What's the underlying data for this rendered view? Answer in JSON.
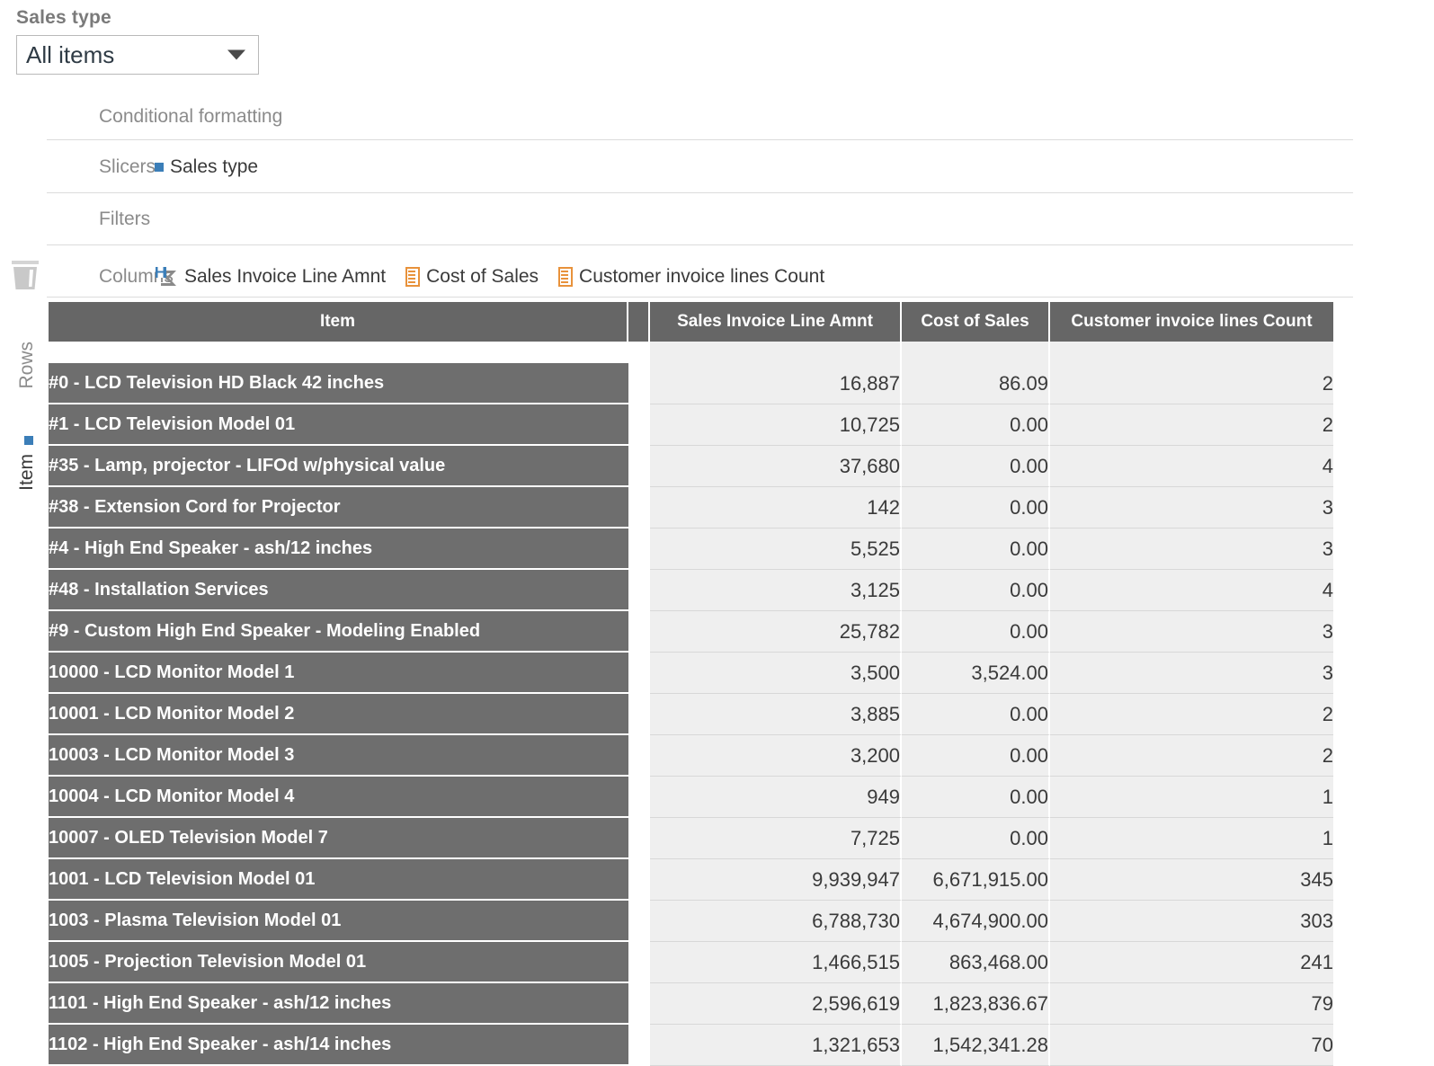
{
  "slicer": {
    "title": "Sales type",
    "selected_value": "All items",
    "caret_icon": "chevron-down-icon"
  },
  "zones": [
    {
      "label": "Conditional formatting",
      "fields": []
    },
    {
      "label": "Slicers",
      "fields": [
        {
          "name": "Sales type",
          "icon": "blue-square-icon"
        }
      ]
    },
    {
      "label": "Filters",
      "fields": []
    },
    {
      "label": "Columns",
      "fields": [
        {
          "name": "Sales Invoice Line Amnt",
          "icon": "sigma-measure-icon"
        },
        {
          "name": "Cost of Sales",
          "icon": "orange-list-icon"
        },
        {
          "name": "Customer invoice lines Count",
          "icon": "orange-list-icon"
        }
      ]
    }
  ],
  "rows_axis": {
    "label": "Rows",
    "field": "Item",
    "bullet_icon": "blue-square-icon"
  },
  "trash": {
    "icon": "trash-bin-icon"
  },
  "colors": {
    "header_gray": "#666666",
    "row_header_gray": "#6e6e6e",
    "cell_gray": "#efefef",
    "accent_blue": "#3b7eb8",
    "accent_orange": "#e8923b"
  },
  "table": {
    "columns": [
      "Item",
      "Sales Invoice Line Amnt",
      "Cost of Sales",
      "Customer invoice lines Count"
    ],
    "rows": [
      {
        "item": "#0 - LCD Television HD Black 42 inches",
        "amnt": "16,887",
        "cost": "86.09",
        "count": "2"
      },
      {
        "item": "#1 - LCD Television Model 01",
        "amnt": "10,725",
        "cost": "0.00",
        "count": "2"
      },
      {
        "item": "#35 - Lamp, projector - LIFOd w/physical value",
        "amnt": "37,680",
        "cost": "0.00",
        "count": "4"
      },
      {
        "item": "#38 - Extension Cord for Projector",
        "amnt": "142",
        "cost": "0.00",
        "count": "3"
      },
      {
        "item": "#4 - High End Speaker - ash/12 inches",
        "amnt": "5,525",
        "cost": "0.00",
        "count": "3"
      },
      {
        "item": "#48 - Installation Services",
        "amnt": "3,125",
        "cost": "0.00",
        "count": "4"
      },
      {
        "item": "#9 - Custom High End Speaker - Modeling Enabled",
        "amnt": "25,782",
        "cost": "0.00",
        "count": "3"
      },
      {
        "item": "10000 - LCD Monitor Model 1",
        "amnt": "3,500",
        "cost": "3,524.00",
        "count": "3"
      },
      {
        "item": "10001 - LCD Monitor Model 2",
        "amnt": "3,885",
        "cost": "0.00",
        "count": "2"
      },
      {
        "item": "10003 - LCD Monitor Model 3",
        "amnt": "3,200",
        "cost": "0.00",
        "count": "2"
      },
      {
        "item": "10004 - LCD Monitor Model 4",
        "amnt": "949",
        "cost": "0.00",
        "count": "1"
      },
      {
        "item": "10007 - OLED Television Model 7",
        "amnt": "7,725",
        "cost": "0.00",
        "count": "1"
      },
      {
        "item": "1001 - LCD Television Model 01",
        "amnt": "9,939,947",
        "cost": "6,671,915.00",
        "count": "345"
      },
      {
        "item": "1003 - Plasma Television Model 01",
        "amnt": "6,788,730",
        "cost": "4,674,900.00",
        "count": "303"
      },
      {
        "item": "1005 - Projection Television Model 01",
        "amnt": "1,466,515",
        "cost": "863,468.00",
        "count": "241"
      },
      {
        "item": "1101 - High End Speaker - ash/12 inches",
        "amnt": "2,596,619",
        "cost": "1,823,836.67",
        "count": "79"
      },
      {
        "item": "1102 - High End Speaker - ash/14 inches",
        "amnt": "1,321,653",
        "cost": "1,542,341.28",
        "count": "70"
      }
    ]
  }
}
